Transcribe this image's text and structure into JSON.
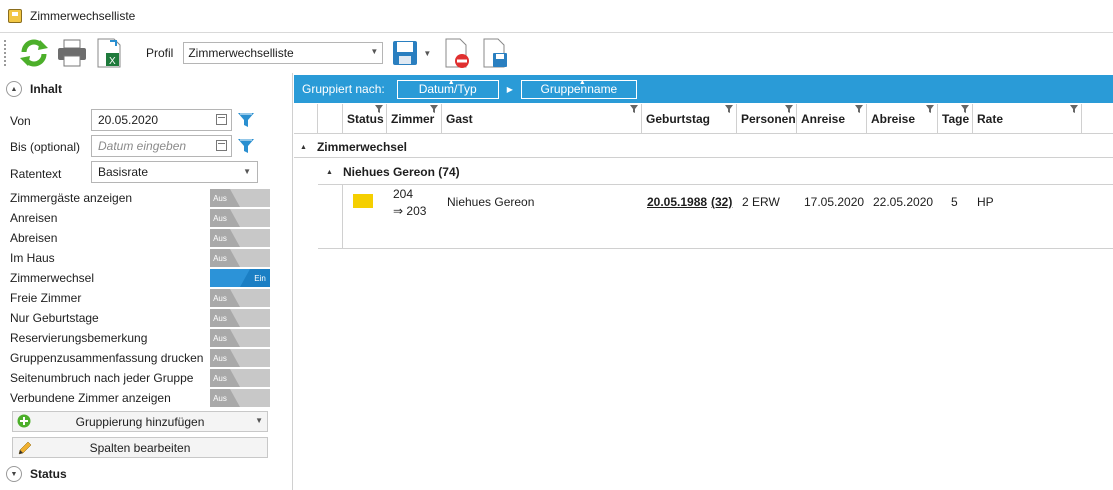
{
  "window": {
    "title": "Zimmerwechselliste"
  },
  "toolbar": {
    "profil_label": "Profil",
    "profil_value": "Zimmerwechselliste"
  },
  "left": {
    "inhalt_label": "Inhalt",
    "von_label": "Von",
    "von_value": "20.05.2020",
    "bis_label": "Bis (optional)",
    "bis_placeholder": "Datum eingeben",
    "ratentext_label": "Ratentext",
    "ratentext_value": "Basisrate",
    "options": [
      {
        "label": "Zimmergäste anzeigen",
        "state": "Aus"
      },
      {
        "label": "Anreisen",
        "state": "Aus"
      },
      {
        "label": "Abreisen",
        "state": "Aus"
      },
      {
        "label": "Im Haus",
        "state": "Aus"
      },
      {
        "label": "Zimmerwechsel",
        "state": "Ein"
      },
      {
        "label": "Freie Zimmer",
        "state": "Aus"
      },
      {
        "label": "Nur Geburtstage",
        "state": "Aus"
      },
      {
        "label": "Reservierungsbemerkung",
        "state": "Aus"
      },
      {
        "label": "Gruppenzusammenfassung drucken",
        "state": "Aus"
      },
      {
        "label": "Seitenumbruch nach jeder Gruppe",
        "state": "Aus"
      },
      {
        "label": "Verbundene Zimmer anzeigen",
        "state": "Aus"
      }
    ],
    "gruppierung_button": "Gruppierung hinzufügen",
    "spalten_button": "Spalten bearbeiten",
    "status_label": "Status"
  },
  "grouping": {
    "label": "Gruppiert nach:",
    "chips": [
      "Datum/Typ",
      "Gruppenname"
    ]
  },
  "columns": [
    "Status",
    "Zimmer",
    "Gast",
    "Geburtstag",
    "Personen",
    "Anreise",
    "Abreise",
    "Tage",
    "Rate"
  ],
  "groups": {
    "level1": "Zimmerwechsel",
    "level2": "Niehues Gereon (74)"
  },
  "row": {
    "status_color": "#f5cf00",
    "zimmer_from": "204",
    "zimmer_to": "⇒ 203",
    "gast": "Niehues Gereon",
    "geburtstag": "20.05.1988",
    "alter": "(32)",
    "personen": "2 ERW",
    "anreise": "17.05.2020",
    "abreise": "22.05.2020",
    "tage": "5",
    "rate": "HP"
  },
  "colors": {
    "accent": "#2a9bd7",
    "toggle_on": "#2c93d8",
    "toggle_off": "#c8c8c8"
  }
}
